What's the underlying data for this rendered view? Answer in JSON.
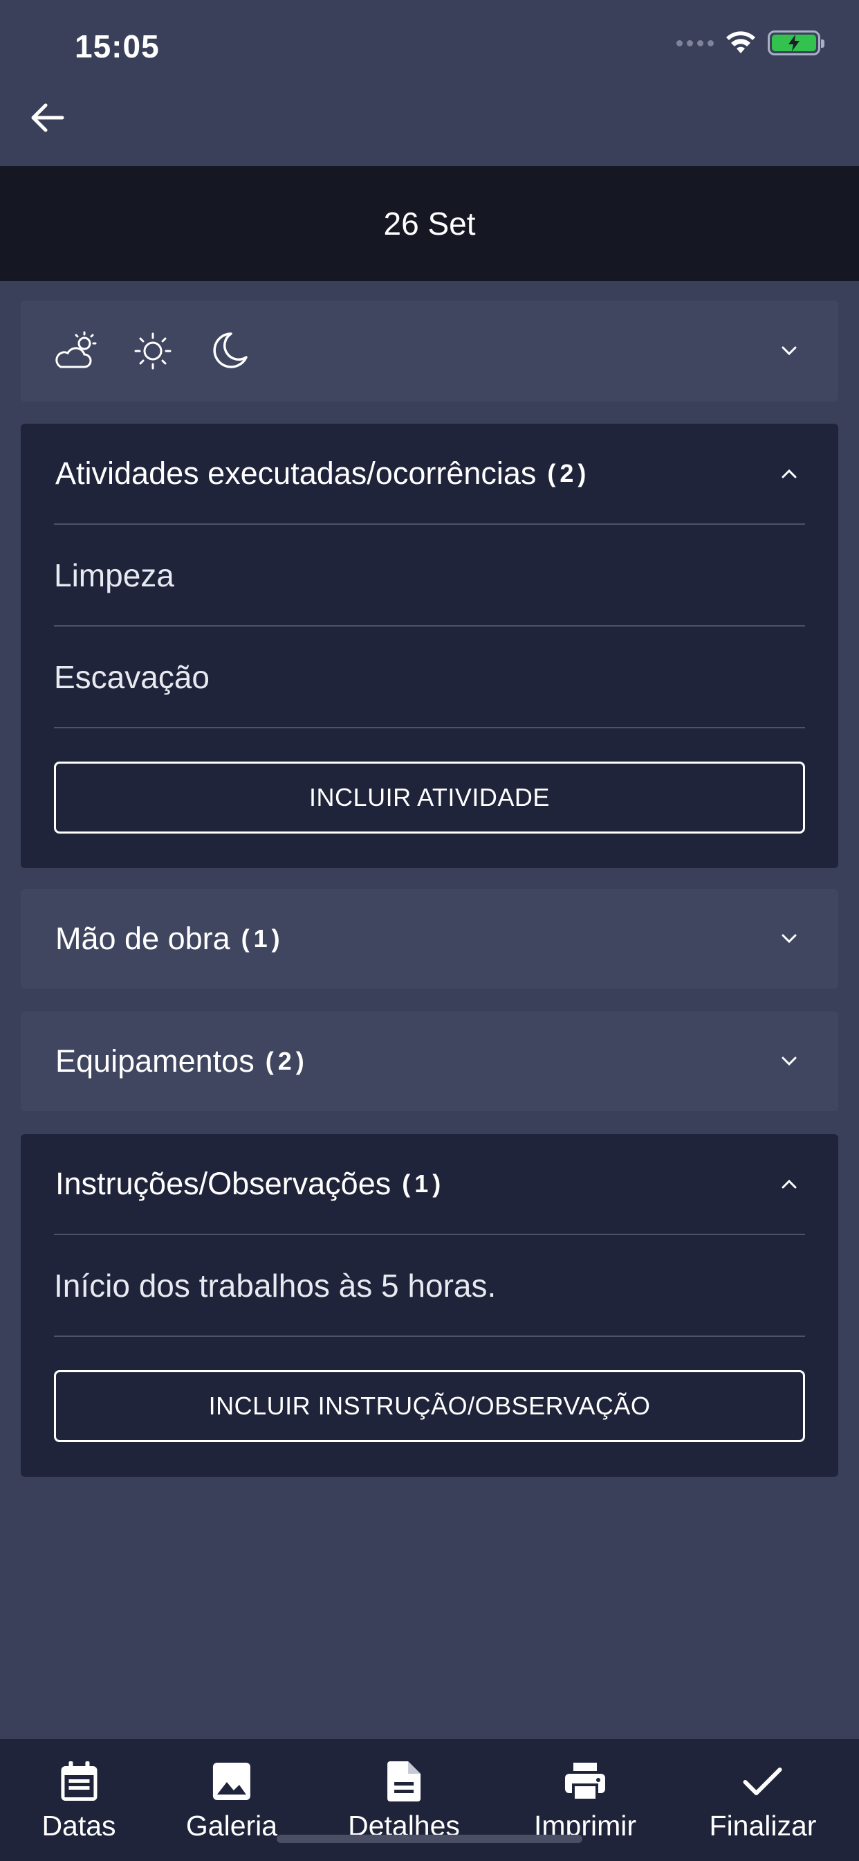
{
  "status_bar": {
    "time": "15:05"
  },
  "header": {
    "date": "26 Set"
  },
  "weather": {
    "icons": [
      "partly-cloudy-icon",
      "sun-icon",
      "moon-icon"
    ]
  },
  "activities": {
    "title": "Atividades executadas/ocorrências",
    "count": "(2)",
    "items": [
      "Limpeza",
      "Escavação"
    ],
    "button_label": "INCLUIR ATIVIDADE"
  },
  "labor": {
    "title": "Mão de obra",
    "count": "(1)"
  },
  "equipment": {
    "title": "Equipamentos",
    "count": "(2)"
  },
  "instructions": {
    "title": "Instruções/Observações",
    "count": "(1)",
    "items": [
      "Início dos trabalhos às 5 horas."
    ],
    "button_label": "INCLUIR INSTRUÇÃO/OBSERVAÇÃO"
  },
  "bottom_nav": [
    {
      "label": "Datas",
      "icon": "calendar-icon"
    },
    {
      "label": "Galeria",
      "icon": "image-icon"
    },
    {
      "label": "Detalhes",
      "icon": "document-icon"
    },
    {
      "label": "Imprimir",
      "icon": "printer-icon"
    },
    {
      "label": "Finalizar",
      "icon": "check-icon"
    }
  ],
  "colors": {
    "background": "#3a4059",
    "date_bar": "#151823",
    "card_expanded": "#20243a",
    "card_collapsed": "#40465f",
    "battery": "#33c24d"
  }
}
